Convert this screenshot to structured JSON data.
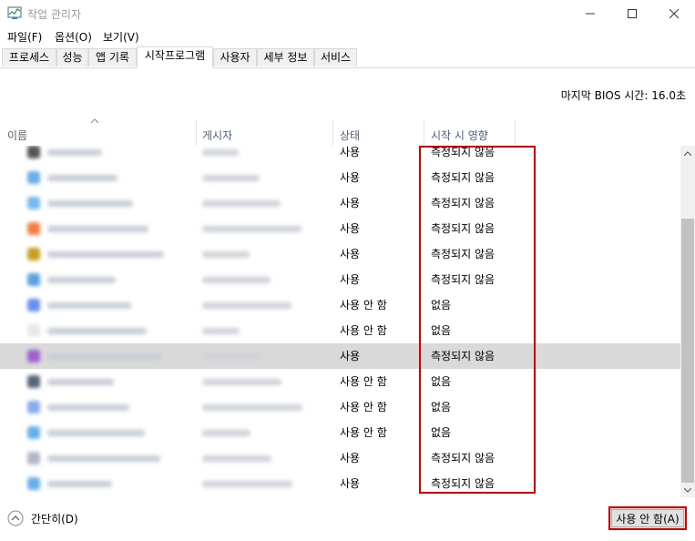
{
  "window": {
    "title": "작업 관리자",
    "icon": "task-manager-icon"
  },
  "menu": [
    "파일(F)",
    "옵션(O)",
    "보기(V)"
  ],
  "tabs": [
    "프로세스",
    "성능",
    "앱 기록",
    "시작프로그램",
    "사용자",
    "세부 정보",
    "서비스"
  ],
  "active_tab": "시작프로그램",
  "bios_time": {
    "label": "마지막 BIOS 시간:",
    "value": "16.0초"
  },
  "columns": {
    "name": "이름",
    "publisher": "게시자",
    "status": "상태",
    "impact": "시작 시 영향"
  },
  "rows": [
    {
      "status": "사용",
      "impact": "측정되지 않음",
      "icon_color": "#555555"
    },
    {
      "status": "사용",
      "impact": "측정되지 않음",
      "icon_color": "#6aaee6"
    },
    {
      "status": "사용",
      "impact": "측정되지 않음",
      "icon_color": "#7ab8f0"
    },
    {
      "status": "사용",
      "impact": "측정되지 않음",
      "icon_color": "#f08040"
    },
    {
      "status": "사용",
      "impact": "측정되지 않음",
      "icon_color": "#c8a020"
    },
    {
      "status": "사용",
      "impact": "측정되지 않음",
      "icon_color": "#5aa0e0"
    },
    {
      "status": "사용 안 함",
      "impact": "없음",
      "icon_color": "#6a8ef0"
    },
    {
      "status": "사용 안 함",
      "impact": "없음",
      "icon_color": "#e8e8e8"
    },
    {
      "status": "사용",
      "impact": "측정되지 않음",
      "icon_color": "#a060d0",
      "selected": true
    },
    {
      "status": "사용 안 함",
      "impact": "없음",
      "icon_color": "#556677"
    },
    {
      "status": "사용 안 함",
      "impact": "없음",
      "icon_color": "#88aaee"
    },
    {
      "status": "사용 안 함",
      "impact": "없음",
      "icon_color": "#66b0e8"
    },
    {
      "status": "사용",
      "impact": "측정되지 않음",
      "icon_color": "#b0b8c8"
    },
    {
      "status": "사용",
      "impact": "측정되지 않음",
      "icon_color": "#6aaee6"
    }
  ],
  "footer": {
    "fewer_details": "간단히(D)",
    "disable_button": "사용 안 함(A)"
  },
  "colors": {
    "highlight": "#d40000",
    "header_text": "#4d6082",
    "selected_row": "#d9d9d9"
  }
}
